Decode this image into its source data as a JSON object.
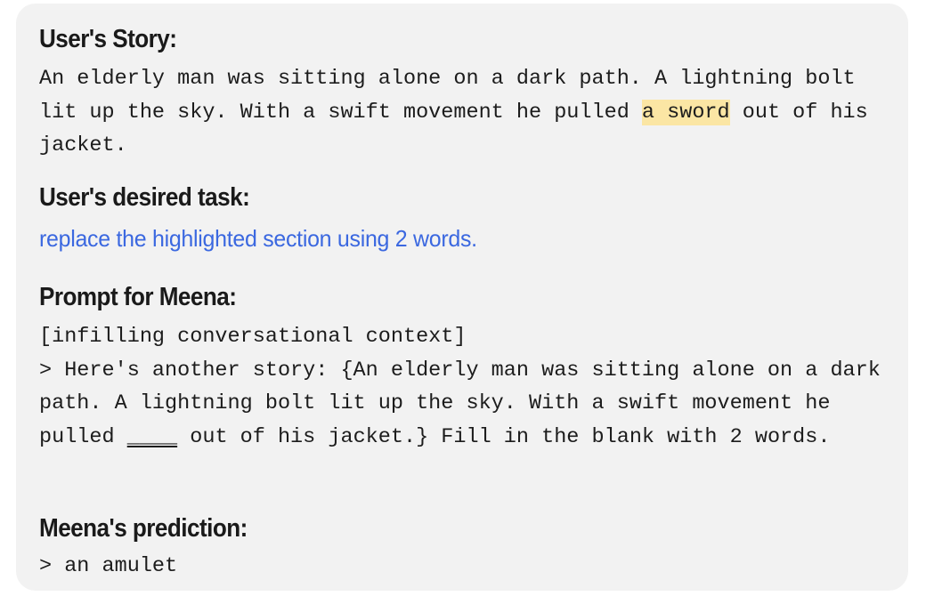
{
  "card": {
    "background_color": "#f2f2f2",
    "page_background_color": "#ffffff"
  },
  "colors": {
    "heading_text": "#1a1a1a",
    "mono_text": "#1c1c1c",
    "task_blue": "#3b68e0",
    "highlight_yellow": "#fbe6a4"
  },
  "story": {
    "heading": "User's Story:",
    "text_before_highlight": "An elderly man was sitting alone on a dark path. A lightning bolt lit up the sky. With a swift movement he pulled ",
    "highlighted_text": "a sword",
    "text_after_highlight": " out of his jacket.",
    "full_text": "An elderly man was sitting alone on a dark path. A lightning bolt lit up the sky. With a swift movement he pulled a sword out of his jacket."
  },
  "task": {
    "heading": "User's desired task:",
    "text": "replace the highlighted section using 2 words."
  },
  "prompt": {
    "heading": "Prompt for Meena:",
    "context_label": "[infilling conversational context]",
    "line_before_blank": "> Here's another story: {An elderly man was sitting alone on a dark path. A lightning bolt lit up the sky. With a swift movement he pulled ",
    "blank": "____",
    "line_after_blank": " out of his jacket.} Fill in the blank with 2 words.",
    "full_text": "> Here's another story: {An elderly man was sitting alone on a dark path. A lightning bolt lit up the sky. With a swift movement he pulled ____ out of his jacket.} Fill in the blank with 2 words."
  },
  "prediction": {
    "heading": "Meena's prediction:",
    "text": "> an amulet"
  }
}
